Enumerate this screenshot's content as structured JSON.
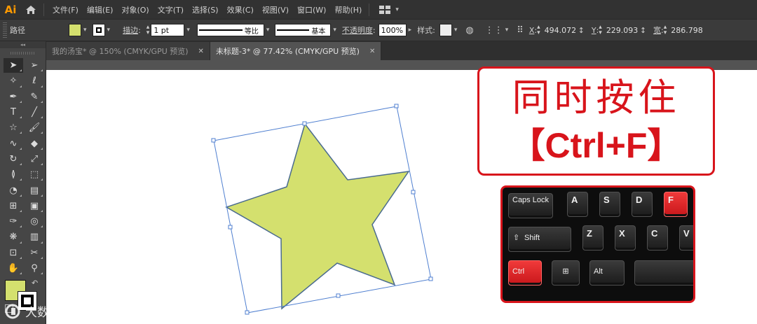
{
  "menubar": {
    "app_logo": "Ai",
    "home_icon": "home-icon",
    "items": [
      "文件(F)",
      "编辑(E)",
      "对象(O)",
      "文字(T)",
      "选择(S)",
      "效果(C)",
      "视图(V)",
      "窗口(W)",
      "帮助(H)"
    ],
    "workspace_icon": "layout-grid-icon"
  },
  "controlbar": {
    "object_label": "路径",
    "fill_color": "#d4e06e",
    "stroke_label": "描边",
    "stroke_weight": "1 pt",
    "profile_label": "等比",
    "brush_label": "基本",
    "opacity_label": "不透明度",
    "opacity_value": "100%",
    "style_label": "样式",
    "x_label": "X",
    "x_value": "494.072",
    "y_label": "Y",
    "y_value": "229.093",
    "w_label": "宽",
    "w_value": "286.798"
  },
  "tabs": [
    {
      "label": "我的汤宝* @ 150% (CMYK/GPU 预览)",
      "active": false
    },
    {
      "label": "未标题-3* @ 77.42% (CMYK/GPU 预览)",
      "active": true
    }
  ],
  "toolbar": {
    "tools": [
      "selection-tool-icon",
      "direct-selection-tool-icon",
      "magic-wand-tool-icon",
      "lasso-tool-icon",
      "pen-tool-icon",
      "curvature-tool-icon",
      "type-tool-icon",
      "line-segment-tool-icon",
      "star-tool-icon",
      "paintbrush-tool-icon",
      "shaper-tool-icon",
      "eraser-tool-icon",
      "rotate-tool-icon",
      "scale-tool-icon",
      "width-tool-icon",
      "free-transform-tool-icon",
      "shape-builder-tool-icon",
      "perspective-grid-tool-icon",
      "mesh-tool-icon",
      "gradient-tool-icon",
      "eyedropper-tool-icon",
      "blend-tool-icon",
      "symbol-sprayer-tool-icon",
      "column-graph-tool-icon",
      "artboard-tool-icon",
      "slice-tool-icon",
      "hand-tool-icon",
      "zoom-tool-icon"
    ],
    "fill_color": "#d4e06e",
    "stroke_color": "#000000"
  },
  "artwork": {
    "shape": "star-shape",
    "fill": "#d4e06e",
    "stroke": "#4a6b8f",
    "bbox_color": "#4f7fd0"
  },
  "annotation": {
    "main_text": "同时按住",
    "shortcut_text": "【Ctrl+F】",
    "accent_color": "#d8141b"
  },
  "keyboard": {
    "keys": {
      "caps": "Caps Lock",
      "a": "A",
      "s": "S",
      "d": "D",
      "f": "F",
      "shift": "Shift",
      "z": "Z",
      "x": "X",
      "c": "C",
      "v": "V",
      "ctrl": "Ctrl",
      "win": "⊞",
      "alt": "Alt",
      "space": ""
    },
    "highlighted": [
      "F",
      "Ctrl"
    ],
    "highlight_color": "#e42020"
  },
  "watermark": {
    "text": "大数跨境"
  }
}
